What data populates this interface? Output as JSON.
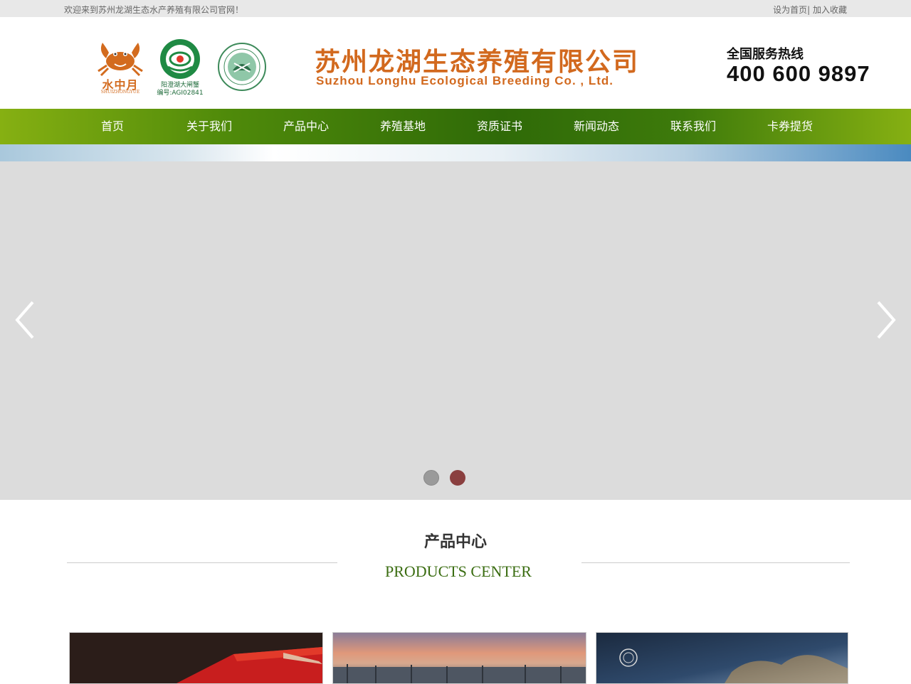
{
  "topbar": {
    "welcome": "欢迎来到苏州龙湖生态水产养殖有限公司官网！",
    "set_home": "设为首页",
    "separator": "|",
    "favorite": "加入收藏"
  },
  "header": {
    "logo_brand": "水中月",
    "logo_brand_sub": "SHUIZHONGYUE",
    "geo_caption_1": "阳澄湖大闸蟹",
    "geo_caption_2": "编号:AGI02841",
    "company_cn": "苏州龙湖生态养殖有限公司",
    "company_en": "Suzhou Longhu Ecological Breeding Co. , Ltd.",
    "hotline_label": "全国服务热线",
    "hotline_number": "400 600 9897"
  },
  "nav": {
    "items": [
      "首页",
      "关于我们",
      "产品中心",
      "养殖基地",
      "资质证书",
      "新闻动态",
      "联系我们",
      "卡券提货"
    ]
  },
  "banner": {
    "active_slide": 2,
    "slide_count": 2
  },
  "products": {
    "title": "产品中心",
    "subtitle": "PRODUCTS CENTER"
  },
  "colors": {
    "accent_orange": "#d2691e",
    "nav_green": "#2f6a08",
    "subtitle_green": "#3b6d12"
  }
}
